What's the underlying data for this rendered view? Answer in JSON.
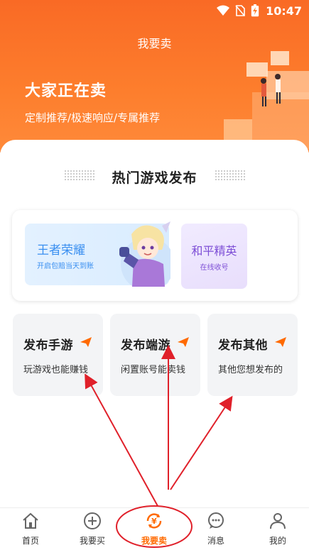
{
  "status_bar": {
    "time": "10:47"
  },
  "page": {
    "title": "我要卖"
  },
  "hero": {
    "title": "大家正在卖",
    "subtitle": "定制推荐/极速响应/专属推荐"
  },
  "section": {
    "title": "热门游戏发布"
  },
  "games": [
    {
      "title": "王者荣耀",
      "subtitle": "开启包赔当天到账"
    },
    {
      "title": "和平精英",
      "subtitle": "在线收号"
    }
  ],
  "publish": [
    {
      "title": "发布手游",
      "subtitle": "玩游戏也能赚钱"
    },
    {
      "title": "发布端游",
      "subtitle": "闲置账号能卖钱"
    },
    {
      "title": "发布其他",
      "subtitle": "其他您想发布的"
    }
  ],
  "nav": [
    {
      "label": "首页",
      "icon": "home-icon"
    },
    {
      "label": "我要买",
      "icon": "plus-circle-icon"
    },
    {
      "label": "我要卖",
      "icon": "yen-cycle-icon"
    },
    {
      "label": "消息",
      "icon": "chat-bubble-icon"
    },
    {
      "label": "我的",
      "icon": "person-icon"
    }
  ],
  "colors": {
    "accent": "#ff6a00",
    "header_bg": "#fd7e2d",
    "annotation_red": "#e0202a"
  }
}
